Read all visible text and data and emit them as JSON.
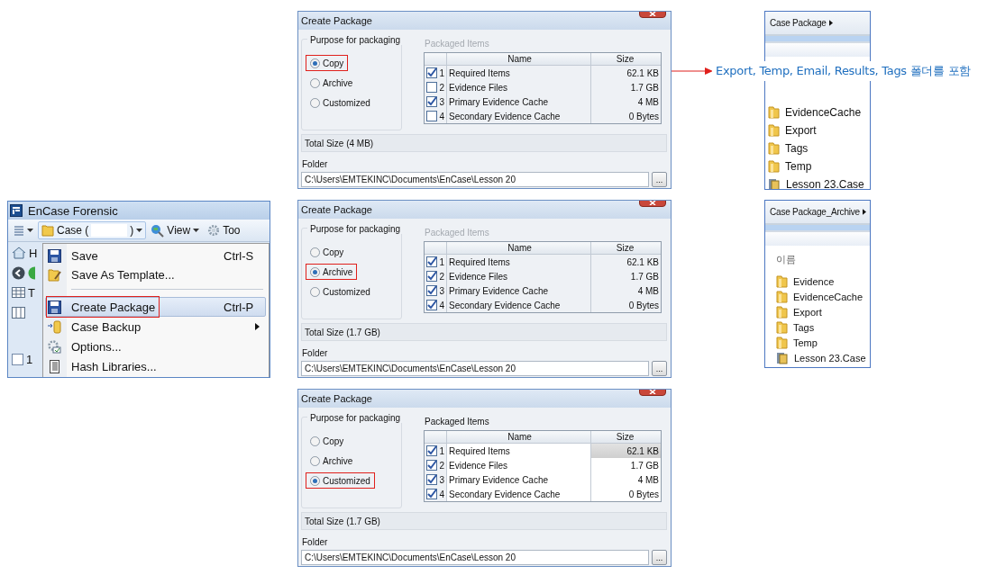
{
  "app_window": {
    "title": "EnCase Forensic",
    "toolbar": [
      {
        "kind": "list"
      },
      {
        "kind": "case",
        "label": "Case (",
        "label_end": ")"
      },
      {
        "kind": "view",
        "label": "View"
      },
      {
        "kind": "tools",
        "label": "Too"
      }
    ],
    "side_strip": {
      "home_label": "H",
      "tab_label": "T",
      "row_label": "1",
      "row_checked": false
    },
    "menu": [
      {
        "label": "Save",
        "shortcut": "Ctrl-S",
        "highlighted": false,
        "submenu": false,
        "separator_after": false
      },
      {
        "label": "Save As Template...",
        "highlighted": false,
        "submenu": false,
        "separator_after": true
      },
      {
        "label": "Create Package",
        "shortcut": "Ctrl-P",
        "highlighted": true,
        "submenu": false,
        "separator_after": false
      },
      {
        "label": "Case Backup",
        "highlighted": false,
        "submenu": true,
        "separator_after": false
      },
      {
        "label": "Options...",
        "highlighted": false,
        "submenu": false,
        "separator_after": false
      },
      {
        "label": "Hash Libraries...",
        "highlighted": false,
        "submenu": false,
        "separator_after": false
      }
    ]
  },
  "dialogs": [
    {
      "title": "Create Package",
      "purpose_label": "Purpose for packaging",
      "items_label": "Packaged Items",
      "items_enabled": false,
      "options": [
        {
          "label": "Copy",
          "selected": true
        },
        {
          "label": "Archive",
          "selected": false
        },
        {
          "label": "Customized",
          "selected": false
        }
      ],
      "columns": [
        "Name",
        "Size"
      ],
      "rows": [
        {
          "checked": true,
          "number": "1",
          "name": "Required Items",
          "size": "62.1 KB"
        },
        {
          "checked": false,
          "number": "2",
          "name": "Evidence Files",
          "size": "1.7 GB"
        },
        {
          "checked": true,
          "number": "3",
          "name": "Primary Evidence Cache",
          "size": "4 MB"
        },
        {
          "checked": false,
          "number": "4",
          "name": "Secondary Evidence Cache",
          "size": "0 Bytes"
        }
      ],
      "total": "Total Size (4 MB)",
      "folder_label": "Folder",
      "folder_value": "C:\\Users\\EMTEKINC\\Documents\\EnCase\\Lesson 20",
      "browse": "..."
    },
    {
      "title": "Create Package",
      "purpose_label": "Purpose for packaging",
      "items_label": "Packaged Items",
      "items_enabled": false,
      "options": [
        {
          "label": "Copy",
          "selected": false
        },
        {
          "label": "Archive",
          "selected": true
        },
        {
          "label": "Customized",
          "selected": false
        }
      ],
      "columns": [
        "Name",
        "Size"
      ],
      "rows": [
        {
          "checked": true,
          "number": "1",
          "name": "Required Items",
          "size": "62.1 KB"
        },
        {
          "checked": true,
          "number": "2",
          "name": "Evidence Files",
          "size": "1.7 GB"
        },
        {
          "checked": true,
          "number": "3",
          "name": "Primary Evidence Cache",
          "size": "4 MB"
        },
        {
          "checked": true,
          "number": "4",
          "name": "Secondary Evidence Cache",
          "size": "0 Bytes"
        }
      ],
      "total": "Total Size (1.7 GB)",
      "folder_label": "Folder",
      "folder_value": "C:\\Users\\EMTEKINC\\Documents\\EnCase\\Lesson 20",
      "browse": "..."
    },
    {
      "title": "Create Package",
      "purpose_label": "Purpose for packaging",
      "items_label": "Packaged Items",
      "items_enabled": true,
      "options": [
        {
          "label": "Copy",
          "selected": false
        },
        {
          "label": "Archive",
          "selected": false
        },
        {
          "label": "Customized",
          "selected": true
        }
      ],
      "columns": [
        "Name",
        "Size"
      ],
      "rows": [
        {
          "checked": true,
          "number": "1",
          "name": "Required Items",
          "size": "62.1 KB"
        },
        {
          "checked": true,
          "number": "2",
          "name": "Evidence Files",
          "size": "1.7 GB"
        },
        {
          "checked": true,
          "number": "3",
          "name": "Primary Evidence Cache",
          "size": "4 MB"
        },
        {
          "checked": true,
          "number": "4",
          "name": "Secondary Evidence Cache",
          "size": "0 Bytes"
        }
      ],
      "total": "Total Size (1.7 GB)",
      "folder_label": "Folder",
      "folder_value": "C:\\Users\\EMTEKINC\\Documents\\EnCase\\Lesson 20",
      "browse": "..."
    }
  ],
  "annotation": "Export, Temp, Email, Results, Tags 폴더를 포함",
  "folder_views": [
    {
      "title": "Case Package",
      "items": [
        {
          "name": "EvidenceCache",
          "kind": "folder"
        },
        {
          "name": "Export",
          "kind": "folder"
        },
        {
          "name": "Tags",
          "kind": "folder"
        },
        {
          "name": "Temp",
          "kind": "folder"
        },
        {
          "name": "Lesson 23.Case",
          "kind": "case"
        }
      ]
    },
    {
      "title": "Case Package_Archive",
      "column_header": "이름",
      "items": [
        {
          "name": "Evidence",
          "kind": "folder"
        },
        {
          "name": "EvidenceCache",
          "kind": "folder"
        },
        {
          "name": "Export",
          "kind": "folder"
        },
        {
          "name": "Tags",
          "kind": "folder"
        },
        {
          "name": "Temp",
          "kind": "folder"
        },
        {
          "name": "Lesson 23.Case",
          "kind": "case"
        }
      ]
    }
  ]
}
